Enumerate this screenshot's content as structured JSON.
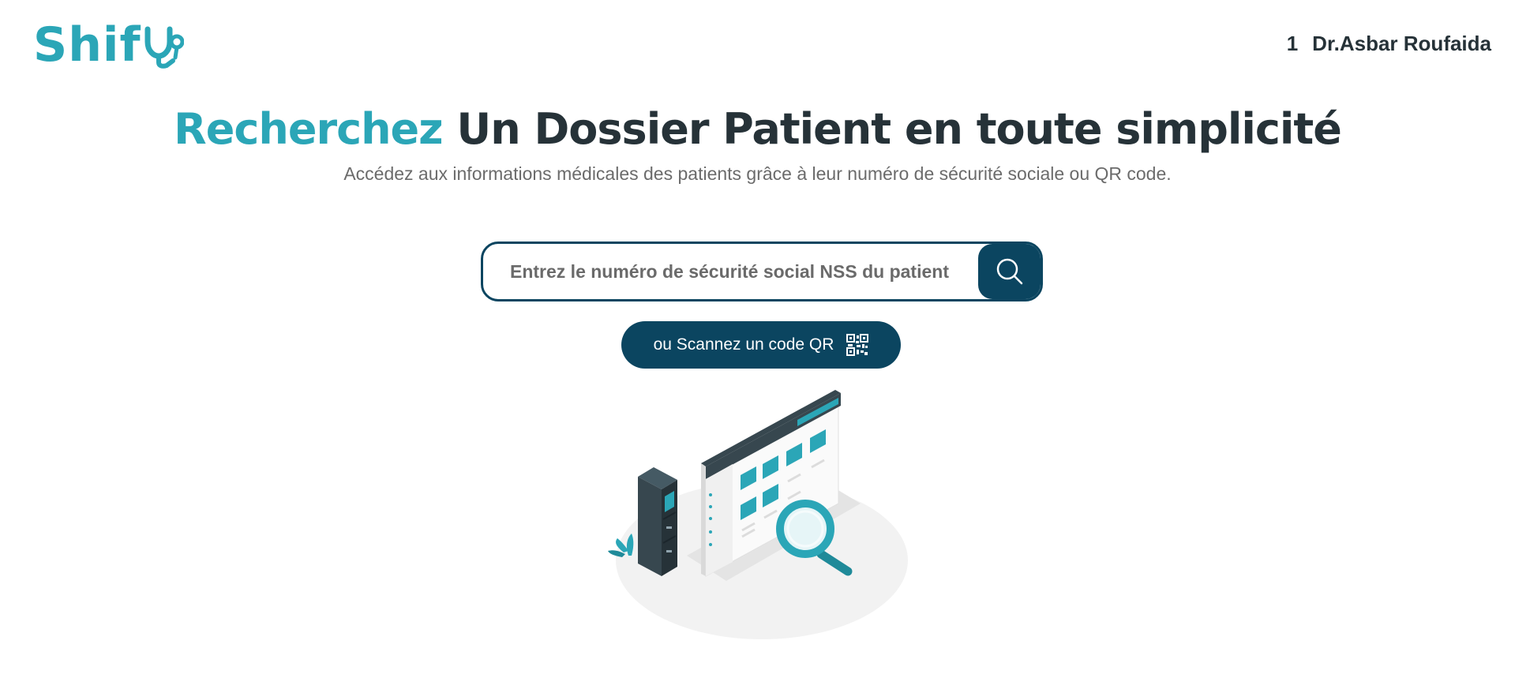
{
  "header": {
    "logo_text": "Shif",
    "logo_icon": "stethoscope-icon",
    "user_badge": "1",
    "user_name": "Dr.Asbar Roufaida"
  },
  "hero": {
    "title_accent": "Recherchez",
    "title_rest": "Un Dossier Patient en toute simplicité",
    "subtitle": "Accédez aux informations médicales des patients grâce à leur numéro de sécurité sociale ou QR code."
  },
  "search": {
    "placeholder": "Entrez le numéro de sécurité social NSS du patient",
    "value": "",
    "button_icon": "search-icon"
  },
  "qr": {
    "label": "ou Scannez un code QR",
    "icon": "qr-code-icon"
  },
  "illustration": {
    "name": "file-search-illustration"
  },
  "colors": {
    "accent": "#2ba6b7",
    "primary": "#0b4560",
    "text": "#263238",
    "muted": "#6b6b6b"
  }
}
